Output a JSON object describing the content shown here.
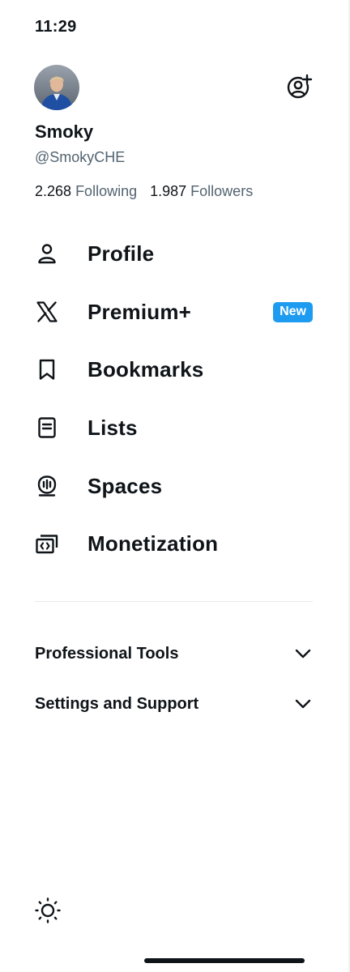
{
  "status_bar": {
    "time": "11:29"
  },
  "account": {
    "display_name": "Smoky",
    "handle": "@SmokyCHE",
    "following_count": "2.268",
    "following_label": "Following",
    "followers_count": "1.987",
    "followers_label": "Followers"
  },
  "nav": {
    "items": [
      {
        "label": "Profile",
        "icon": "person-icon"
      },
      {
        "label": "Premium+",
        "icon": "x-logo-icon",
        "badge": "New"
      },
      {
        "label": "Bookmarks",
        "icon": "bookmark-icon"
      },
      {
        "label": "Lists",
        "icon": "list-icon"
      },
      {
        "label": "Spaces",
        "icon": "spaces-icon"
      },
      {
        "label": "Monetization",
        "icon": "money-icon"
      }
    ]
  },
  "sections": [
    {
      "label": "Professional Tools",
      "icon": "chevron-down-icon"
    },
    {
      "label": "Settings and Support",
      "icon": "chevron-down-icon"
    }
  ],
  "footer": {
    "theme_icon": "sun-icon"
  },
  "colors": {
    "text": "#0f1419",
    "secondary_text": "#536471",
    "accent": "#1d9bf0",
    "divider": "#e7eaec"
  }
}
